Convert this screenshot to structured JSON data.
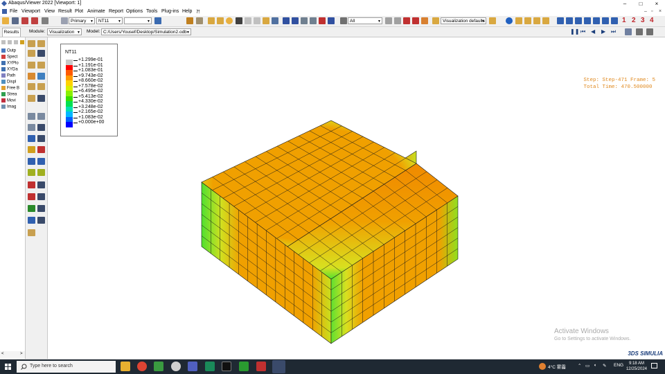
{
  "window": {
    "title": "Abaqus/Viewer 2022 [Viewport: 1]",
    "controls": [
      "–",
      "□",
      "×"
    ]
  },
  "mdi_controls": [
    "–",
    "▫",
    "×"
  ],
  "menu": [
    "File",
    "Viewport",
    "View",
    "Result",
    "Plot",
    "Animate",
    "Report",
    "Options",
    "Tools",
    "Plug-ins",
    "Help",
    "⁈"
  ],
  "toolbar": {
    "primary_combo": "Primary",
    "variable_combo": "NT11",
    "blank_combo": "",
    "selection_combo": "All",
    "viz_defaults_combo": "Visualization defaults",
    "view_numbers": [
      "1",
      "2",
      "3",
      "4"
    ]
  },
  "row2": {
    "results_tab": "Results",
    "module_label": "Module:",
    "module_value": "Visualization",
    "model_label": "Model:",
    "model_value": "C:/Users/Yousef/Desktop/Simulation2.odb"
  },
  "tree_items": [
    "Outp",
    "Spect",
    "XYPlo",
    "XYDa",
    "Path",
    "Displ",
    "Free B",
    "Strea",
    "Movi",
    "Imag"
  ],
  "legend": {
    "title": "NT11",
    "entries": [
      {
        "label": "+1.299e-01",
        "color": "#c8c8c8"
      },
      {
        "label": "+1.191e-01",
        "color": "#ff0000"
      },
      {
        "label": "+1.083e-01",
        "color": "#ff5a00"
      },
      {
        "label": "+9.743e-02",
        "color": "#ff9a00"
      },
      {
        "label": "+8.660e-02",
        "color": "#ffd300"
      },
      {
        "label": "+7.578e-02",
        "color": "#d8f000"
      },
      {
        "label": "+6.495e-02",
        "color": "#8af000"
      },
      {
        "label": "+5.413e-02",
        "color": "#38e000"
      },
      {
        "label": "+4.330e-02",
        "color": "#00e050"
      },
      {
        "label": "+3.248e-02",
        "color": "#00e0b0"
      },
      {
        "label": "+2.165e-02",
        "color": "#00b8ff"
      },
      {
        "label": "+1.083e-02",
        "color": "#0060ff"
      },
      {
        "label": "+0.000e+00",
        "color": "#0000ff"
      }
    ]
  },
  "step_info": {
    "step": "Step: Step-471  Frame: 5",
    "time": "Total Time: 470.500000"
  },
  "watermark": {
    "line1": "Activate Windows",
    "line2": "Go to Settings to activate Windows."
  },
  "brand": "3DS SIMULIA",
  "taskbar": {
    "search_placeholder": "Type here to search",
    "weather": "4°C  雾霾",
    "lang": "ENG",
    "time": "9:18 AM",
    "date": "12/25/2024"
  },
  "colors": {
    "accent_red": "#c0272d",
    "step_text": "#e08a20",
    "taskbar": "#1f2933",
    "brand": "#1a3d7a"
  }
}
